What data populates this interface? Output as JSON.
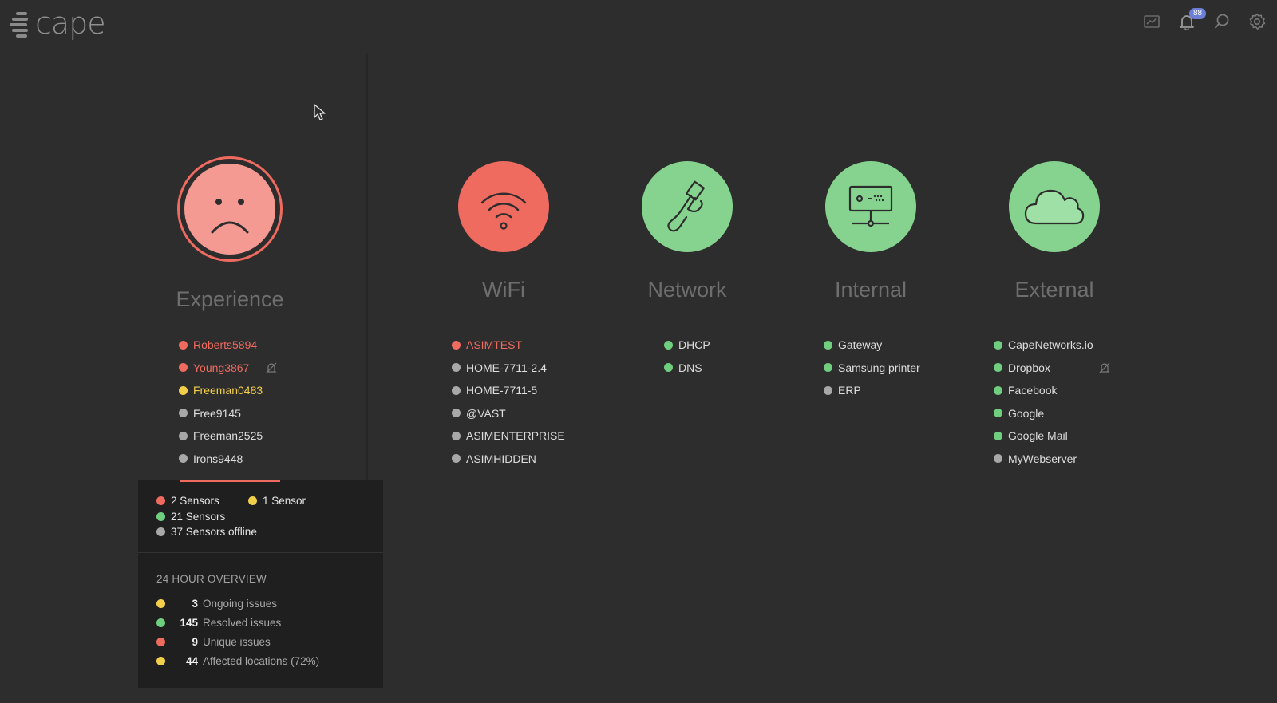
{
  "app": {
    "logo_text": "cape"
  },
  "topbar": {
    "notifications_count": "88"
  },
  "columns": {
    "experience": {
      "title": "Experience",
      "status": "red",
      "icon": "sad-face-icon"
    },
    "wifi": {
      "title": "WiFi",
      "status": "red",
      "icon": "wifi-icon"
    },
    "network": {
      "title": "Network",
      "status": "green",
      "icon": "ethernet-cable-icon"
    },
    "internal": {
      "title": "Internal",
      "status": "green",
      "icon": "server-icon"
    },
    "external": {
      "title": "External",
      "status": "green",
      "icon": "cloud-icon"
    }
  },
  "lists": {
    "experience": [
      {
        "label": "Roberts5894",
        "status": "red"
      },
      {
        "label": "Young3867",
        "status": "red",
        "muted": true
      },
      {
        "label": "Freeman0483",
        "status": "yellow"
      },
      {
        "label": "Free9145",
        "status": "gray"
      },
      {
        "label": "Freeman2525",
        "status": "gray"
      },
      {
        "label": "Irons9448",
        "status": "gray"
      }
    ],
    "wifi": [
      {
        "label": "ASIMTEST",
        "status": "red"
      },
      {
        "label": "HOME-7711-2.4",
        "status": "gray"
      },
      {
        "label": "HOME-7711-5",
        "status": "gray"
      },
      {
        "label": "@VAST",
        "status": "gray"
      },
      {
        "label": "ASIMENTERPRISE",
        "status": "gray"
      },
      {
        "label": "ASIMHIDDEN",
        "status": "gray"
      }
    ],
    "network": [
      {
        "label": "DHCP",
        "status": "green"
      },
      {
        "label": "DNS",
        "status": "green"
      }
    ],
    "internal": [
      {
        "label": "Gateway",
        "status": "green"
      },
      {
        "label": "Samsung printer",
        "status": "green"
      },
      {
        "label": "ERP",
        "status": "gray"
      }
    ],
    "external": [
      {
        "label": "CapeNetworks.io",
        "status": "green"
      },
      {
        "label": "Dropbox",
        "status": "green",
        "muted": true
      },
      {
        "label": "Facebook",
        "status": "green"
      },
      {
        "label": "Google",
        "status": "green"
      },
      {
        "label": "Google Mail",
        "status": "green"
      },
      {
        "label": "MyWebserver",
        "status": "gray"
      }
    ]
  },
  "sensors": {
    "red": "2 Sensors",
    "yellow": "1 Sensor",
    "green": "21 Sensors",
    "offline": "37 Sensors offline"
  },
  "overview": {
    "title": "24 HOUR OVERVIEW",
    "rows": [
      {
        "num": "3",
        "label": "Ongoing issues",
        "status": "yellow"
      },
      {
        "num": "145",
        "label": "Resolved issues",
        "status": "green"
      },
      {
        "num": "9",
        "label": "Unique issues",
        "status": "red"
      },
      {
        "num": "44",
        "label": "Affected locations (72%)",
        "status": "yellow"
      }
    ]
  },
  "colors": {
    "red": "#ef6b60",
    "green": "#86d38f",
    "yellow": "#f2cf4b",
    "gray": "#a8a8a8",
    "background": "#2d2d2d",
    "panel": "#1f1f1f",
    "badge": "#6b7fd7"
  }
}
